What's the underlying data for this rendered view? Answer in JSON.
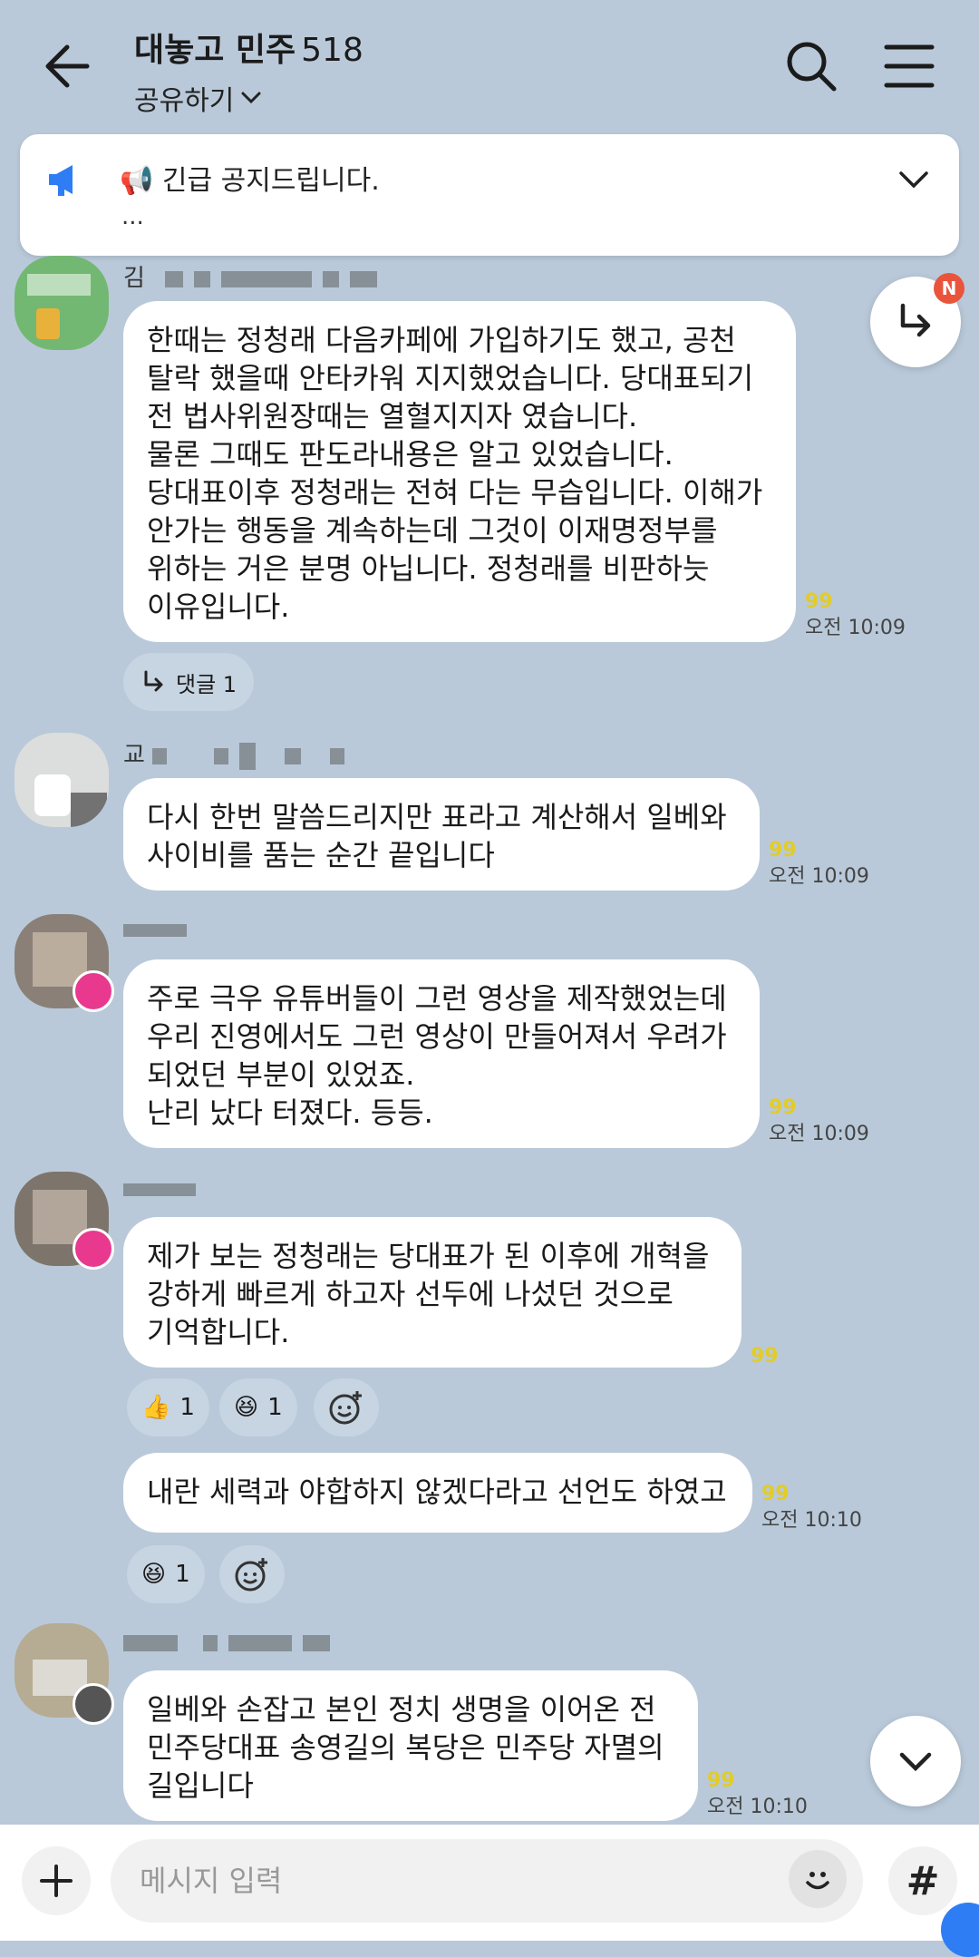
{
  "header": {
    "title": "대놓고 민주",
    "member_count": "518",
    "share_label": "공유하기"
  },
  "notice": {
    "text": "📢 긴급 공지드립니다.",
    "more": "..."
  },
  "messages": [
    {
      "sender": "김",
      "text": "한때는 정청래 다음카페에 가입하기도 했고, 공천\n탈락 했을때 안타카워 지지했었습니다. 당대표되기\n전 법사위원장때는 열혈지지자 였습니다.\n물론 그때도 판도라내용은 알고 있었습니다.\n당대표이후 정청래는 전혀 다는 무습입니다. 이해가\n안가는 행동을 계속하는데 그것이 이재명정부를\n위하는 거은 분명 아닙니다. 정청래를 비판하늣\n이유입니다.",
      "time": "오전 10:09",
      "reply_count_label": "댓글 1"
    },
    {
      "sender": "교",
      "text": "다시 한번 말씀드리지만 표라고 계산해서 일베와\n사이비를 품는 순간 끝입니다",
      "time": "오전 10:09"
    },
    {
      "sender": "",
      "text": "주로 극우 유튜버들이 그런 영상을 제작했었는데\n우리 진영에서도 그런 영상이 만들어져서 우려가\n되었던 부분이 있었죠.\n난리 났다 터졌다. 등등.",
      "time": "오전 10:09"
    },
    {
      "sender": "",
      "text": "제가 보는 정청래는 당대표가 된 이후에 개혁을\n강하게 빠르게 하고자 선두에 나섰던 것으로\n기억합니다.",
      "reactions": [
        {
          "emoji": "👍",
          "count": "1"
        },
        {
          "emoji": "😆",
          "count": "1"
        }
      ]
    },
    {
      "sender": "",
      "text": "내란 세력과 야합하지 않겠다라고 선언도 하였고",
      "time": "오전 10:10",
      "reactions": [
        {
          "emoji": "😆",
          "count": "1"
        }
      ]
    },
    {
      "sender": "",
      "text": "일베와 손잡고 본인 정치 생명을 이어온 전\n민주당대표 송영길의 복당은 민주당 자멸의\n길입니다",
      "time": "오전 10:10"
    }
  ],
  "unread_mark": "99",
  "floating": {
    "badge": "N"
  },
  "input": {
    "placeholder": "메시지 입력",
    "hash_label": "#"
  },
  "colors": {
    "background": "#b9c9d9",
    "bubble": "#ffffff",
    "badge": "#e9553c",
    "crown": "#e9398e"
  }
}
